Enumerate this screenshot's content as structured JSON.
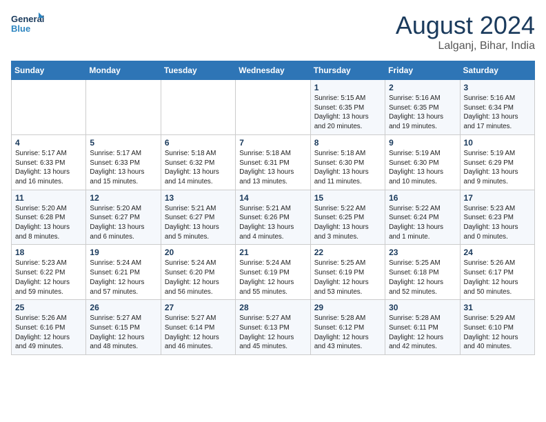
{
  "logo": {
    "line1": "General",
    "line2": "Blue"
  },
  "title": "August 2024",
  "location": "Lalganj, Bihar, India",
  "weekdays": [
    "Sunday",
    "Monday",
    "Tuesday",
    "Wednesday",
    "Thursday",
    "Friday",
    "Saturday"
  ],
  "weeks": [
    [
      {
        "day": "",
        "content": ""
      },
      {
        "day": "",
        "content": ""
      },
      {
        "day": "",
        "content": ""
      },
      {
        "day": "",
        "content": ""
      },
      {
        "day": "1",
        "content": "Sunrise: 5:15 AM\nSunset: 6:35 PM\nDaylight: 13 hours\nand 20 minutes."
      },
      {
        "day": "2",
        "content": "Sunrise: 5:16 AM\nSunset: 6:35 PM\nDaylight: 13 hours\nand 19 minutes."
      },
      {
        "day": "3",
        "content": "Sunrise: 5:16 AM\nSunset: 6:34 PM\nDaylight: 13 hours\nand 17 minutes."
      }
    ],
    [
      {
        "day": "4",
        "content": "Sunrise: 5:17 AM\nSunset: 6:33 PM\nDaylight: 13 hours\nand 16 minutes."
      },
      {
        "day": "5",
        "content": "Sunrise: 5:17 AM\nSunset: 6:33 PM\nDaylight: 13 hours\nand 15 minutes."
      },
      {
        "day": "6",
        "content": "Sunrise: 5:18 AM\nSunset: 6:32 PM\nDaylight: 13 hours\nand 14 minutes."
      },
      {
        "day": "7",
        "content": "Sunrise: 5:18 AM\nSunset: 6:31 PM\nDaylight: 13 hours\nand 13 minutes."
      },
      {
        "day": "8",
        "content": "Sunrise: 5:18 AM\nSunset: 6:30 PM\nDaylight: 13 hours\nand 11 minutes."
      },
      {
        "day": "9",
        "content": "Sunrise: 5:19 AM\nSunset: 6:30 PM\nDaylight: 13 hours\nand 10 minutes."
      },
      {
        "day": "10",
        "content": "Sunrise: 5:19 AM\nSunset: 6:29 PM\nDaylight: 13 hours\nand 9 minutes."
      }
    ],
    [
      {
        "day": "11",
        "content": "Sunrise: 5:20 AM\nSunset: 6:28 PM\nDaylight: 13 hours\nand 8 minutes."
      },
      {
        "day": "12",
        "content": "Sunrise: 5:20 AM\nSunset: 6:27 PM\nDaylight: 13 hours\nand 6 minutes."
      },
      {
        "day": "13",
        "content": "Sunrise: 5:21 AM\nSunset: 6:27 PM\nDaylight: 13 hours\nand 5 minutes."
      },
      {
        "day": "14",
        "content": "Sunrise: 5:21 AM\nSunset: 6:26 PM\nDaylight: 13 hours\nand 4 minutes."
      },
      {
        "day": "15",
        "content": "Sunrise: 5:22 AM\nSunset: 6:25 PM\nDaylight: 13 hours\nand 3 minutes."
      },
      {
        "day": "16",
        "content": "Sunrise: 5:22 AM\nSunset: 6:24 PM\nDaylight: 13 hours\nand 1 minute."
      },
      {
        "day": "17",
        "content": "Sunrise: 5:23 AM\nSunset: 6:23 PM\nDaylight: 13 hours\nand 0 minutes."
      }
    ],
    [
      {
        "day": "18",
        "content": "Sunrise: 5:23 AM\nSunset: 6:22 PM\nDaylight: 12 hours\nand 59 minutes."
      },
      {
        "day": "19",
        "content": "Sunrise: 5:24 AM\nSunset: 6:21 PM\nDaylight: 12 hours\nand 57 minutes."
      },
      {
        "day": "20",
        "content": "Sunrise: 5:24 AM\nSunset: 6:20 PM\nDaylight: 12 hours\nand 56 minutes."
      },
      {
        "day": "21",
        "content": "Sunrise: 5:24 AM\nSunset: 6:19 PM\nDaylight: 12 hours\nand 55 minutes."
      },
      {
        "day": "22",
        "content": "Sunrise: 5:25 AM\nSunset: 6:19 PM\nDaylight: 12 hours\nand 53 minutes."
      },
      {
        "day": "23",
        "content": "Sunrise: 5:25 AM\nSunset: 6:18 PM\nDaylight: 12 hours\nand 52 minutes."
      },
      {
        "day": "24",
        "content": "Sunrise: 5:26 AM\nSunset: 6:17 PM\nDaylight: 12 hours\nand 50 minutes."
      }
    ],
    [
      {
        "day": "25",
        "content": "Sunrise: 5:26 AM\nSunset: 6:16 PM\nDaylight: 12 hours\nand 49 minutes."
      },
      {
        "day": "26",
        "content": "Sunrise: 5:27 AM\nSunset: 6:15 PM\nDaylight: 12 hours\nand 48 minutes."
      },
      {
        "day": "27",
        "content": "Sunrise: 5:27 AM\nSunset: 6:14 PM\nDaylight: 12 hours\nand 46 minutes."
      },
      {
        "day": "28",
        "content": "Sunrise: 5:27 AM\nSunset: 6:13 PM\nDaylight: 12 hours\nand 45 minutes."
      },
      {
        "day": "29",
        "content": "Sunrise: 5:28 AM\nSunset: 6:12 PM\nDaylight: 12 hours\nand 43 minutes."
      },
      {
        "day": "30",
        "content": "Sunrise: 5:28 AM\nSunset: 6:11 PM\nDaylight: 12 hours\nand 42 minutes."
      },
      {
        "day": "31",
        "content": "Sunrise: 5:29 AM\nSunset: 6:10 PM\nDaylight: 12 hours\nand 40 minutes."
      }
    ]
  ]
}
